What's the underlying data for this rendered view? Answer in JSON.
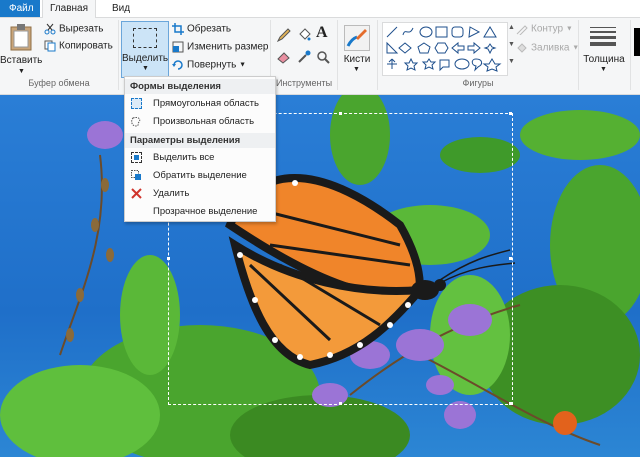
{
  "tabs": {
    "file": "Файл",
    "home": "Главная",
    "view": "Вид"
  },
  "clipboard": {
    "paste": "Вставить",
    "cut": "Вырезать",
    "copy": "Копировать",
    "group": "Буфер обмена"
  },
  "image": {
    "select": "Выделить",
    "crop": "Обрезать",
    "resize": "Изменить размер",
    "rotate": "Повернуть",
    "group": ""
  },
  "tools": {
    "group": "Инструменты"
  },
  "brushes": {
    "label": "Кисти"
  },
  "shapes": {
    "outline": "Контур",
    "fill": "Заливка",
    "group": "Фигуры"
  },
  "size": {
    "label": "Толщина"
  },
  "menu": {
    "shapes_header": "Формы выделения",
    "rect": "Прямоугольная область",
    "free": "Произвольная область",
    "options_header": "Параметры выделения",
    "select_all": "Выделить все",
    "invert": "Обратить выделение",
    "delete": "Удалить",
    "transparent": "Прозрачное выделение"
  },
  "colors": {
    "accent": "#1979ca",
    "selected": "#cce4f7",
    "delete_x": "#d0342c"
  }
}
